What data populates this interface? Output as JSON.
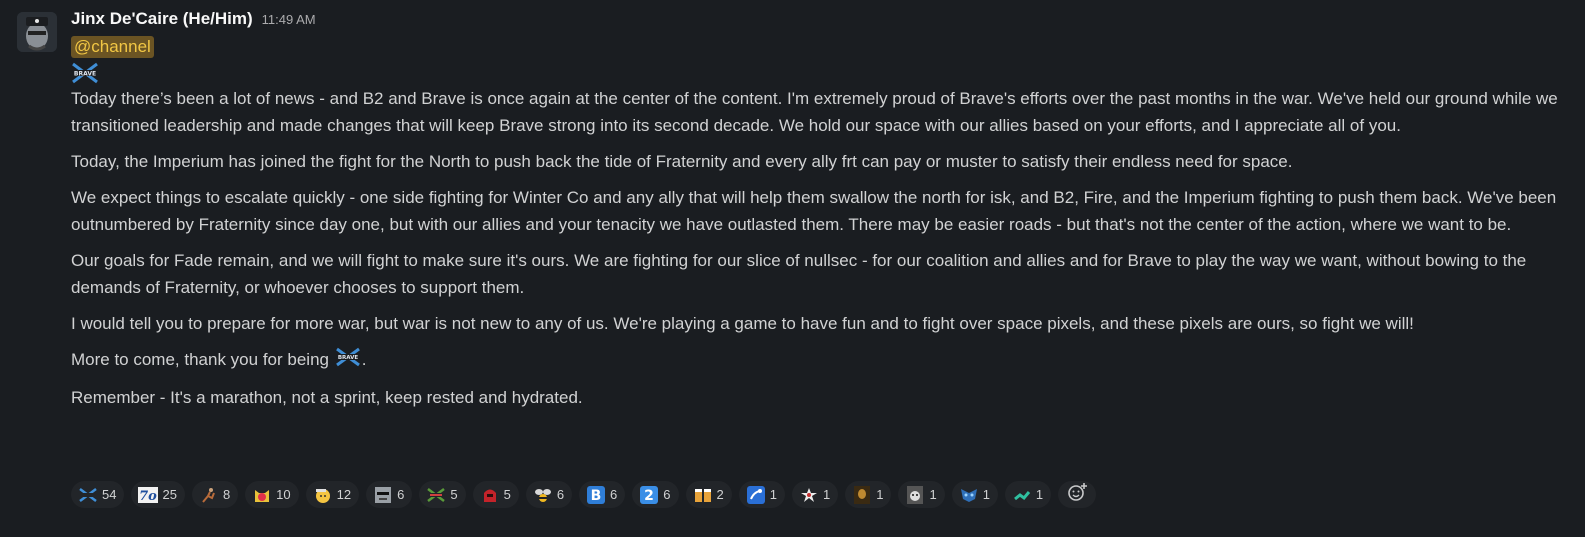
{
  "message": {
    "author": "Jinx De'Caire (He/Him)",
    "timestamp": "11:49 AM",
    "mention": "@channel",
    "paragraphs": [
      "Today there’s been a lot of news - and B2 and Brave is once again at the center of the content.  I'm extremely proud of Brave's efforts over the past months in the war.  We've held our ground while we transitioned leadership and made changes that will keep Brave strong into its second decade.  We hold our space with our allies based on your efforts, and I appreciate all of you.",
      "Today, the Imperium has joined the fight for the North to push back the tide of Fraternity and every ally frt can pay or muster to satisfy their endless need for space.",
      "We expect things to escalate quickly - one side fighting for Winter Co and any ally that will help them swallow the north for isk, and B2, Fire, and the Imperium fighting to push them back.  We've been outnumbered by Fraternity since day one, but with our allies and your tenacity we have outlasted them.  There may be easier roads - but that's not the center of the action, where we want to be.",
      "Our goals for Fade remain, and we will fight to make sure it's ours.  We are fighting for our slice of nullsec - for our coalition and allies and for Brave to play the way we want, without bowing to the demands of Fraternity, or whoever chooses to support them.",
      "I would tell you to prepare for more war, but war is not new to any of us.  We're playing a game to have fun and to fight over space pixels, and these pixels are ours, so fight we will!"
    ],
    "closing_before": "More to come, thank you for being ",
    "closing_after": ".",
    "remember": "Remember - It's a marathon, not a sprint, keep rested and hydrated."
  },
  "reactions": [
    {
      "icon": "brave-emoji",
      "count": "54"
    },
    {
      "icon": "7o-emoji",
      "count": "25"
    },
    {
      "icon": "runner-emoji",
      "count": "8"
    },
    {
      "icon": "angry-cat-emoji",
      "count": "10"
    },
    {
      "icon": "salute-face-emoji",
      "count": "12"
    },
    {
      "icon": "sunglasses-face-emoji",
      "count": "6"
    },
    {
      "icon": "brave-alt-emoji",
      "count": "5"
    },
    {
      "icon": "red-helmet-emoji",
      "count": "5"
    },
    {
      "icon": "bee-emoji",
      "count": "6"
    },
    {
      "icon": "letter-b-emoji",
      "count": "6"
    },
    {
      "icon": "number-2-emoji",
      "count": "6"
    },
    {
      "icon": "beers-emoji",
      "count": "2"
    },
    {
      "icon": "fire-hose-emoji",
      "count": "1"
    },
    {
      "icon": "white-star-emoji",
      "count": "1"
    },
    {
      "icon": "dark-portrait-emoji",
      "count": "1"
    },
    {
      "icon": "cat-portrait-emoji",
      "count": "1"
    },
    {
      "icon": "blue-mask-emoji",
      "count": "1"
    },
    {
      "icon": "green-fist-emoji",
      "count": "1"
    }
  ],
  "colors": {
    "background": "#1a1d21",
    "mention_bg": "#6b5423",
    "mention_fg": "#f2c744",
    "reaction_bg": "#222529"
  }
}
